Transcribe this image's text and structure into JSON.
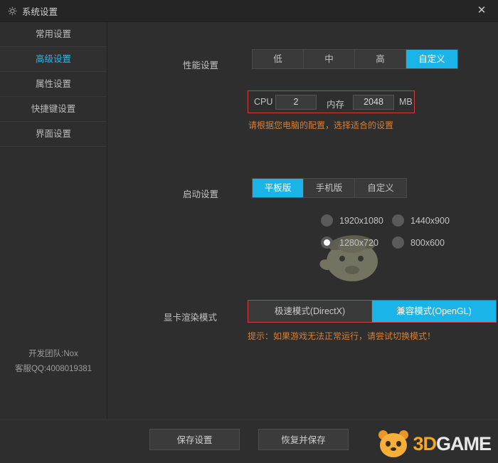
{
  "window": {
    "title": "系统设置",
    "gear_icon": "gear-icon",
    "close_icon": "✕"
  },
  "sidebar": {
    "items": [
      {
        "label": "常用设置",
        "active": false
      },
      {
        "label": "高级设置",
        "active": true
      },
      {
        "label": "属性设置",
        "active": false
      },
      {
        "label": "快捷键设置",
        "active": false
      },
      {
        "label": "界面设置",
        "active": false
      }
    ],
    "footer": {
      "team": "开发团队:Nox",
      "qq": "客服QQ:4008019381"
    }
  },
  "performance": {
    "label": "性能设置",
    "options": [
      "低",
      "中",
      "高",
      "自定义"
    ],
    "selected": "自定义",
    "cpu_label": "CPU",
    "cpu_value": "2",
    "mem_label": "内存",
    "mem_value": "2048",
    "mem_unit": "MB",
    "hint": "请根据您电脑的配置，选择适合的设置"
  },
  "startup": {
    "label": "启动设置",
    "options": [
      "平板版",
      "手机版",
      "自定义"
    ],
    "selected": "平板版",
    "resolutions": [
      {
        "label": "1920x1080",
        "selected": false
      },
      {
        "label": "1440x900",
        "selected": false
      },
      {
        "label": "1280x720",
        "selected": true
      },
      {
        "label": "800x600",
        "selected": false
      }
    ]
  },
  "render": {
    "label": "显卡渲染模式",
    "options": [
      "极速模式(DirectX)",
      "兼容模式(OpenGL)"
    ],
    "selected": "兼容模式(OpenGL)",
    "hint": "提示：如果游戏无法正常运行，请尝试切换模式！"
  },
  "bottom": {
    "save_label": "保存设置",
    "restore_label": "恢复并保存"
  },
  "watermark": {
    "text_3d": "3D",
    "text_game": "GAME"
  },
  "colors": {
    "accent": "#1ab4e8",
    "active_text": "#2bb8e6",
    "red_outline": "#d23c3c",
    "hint_orange": "#d4803a"
  }
}
